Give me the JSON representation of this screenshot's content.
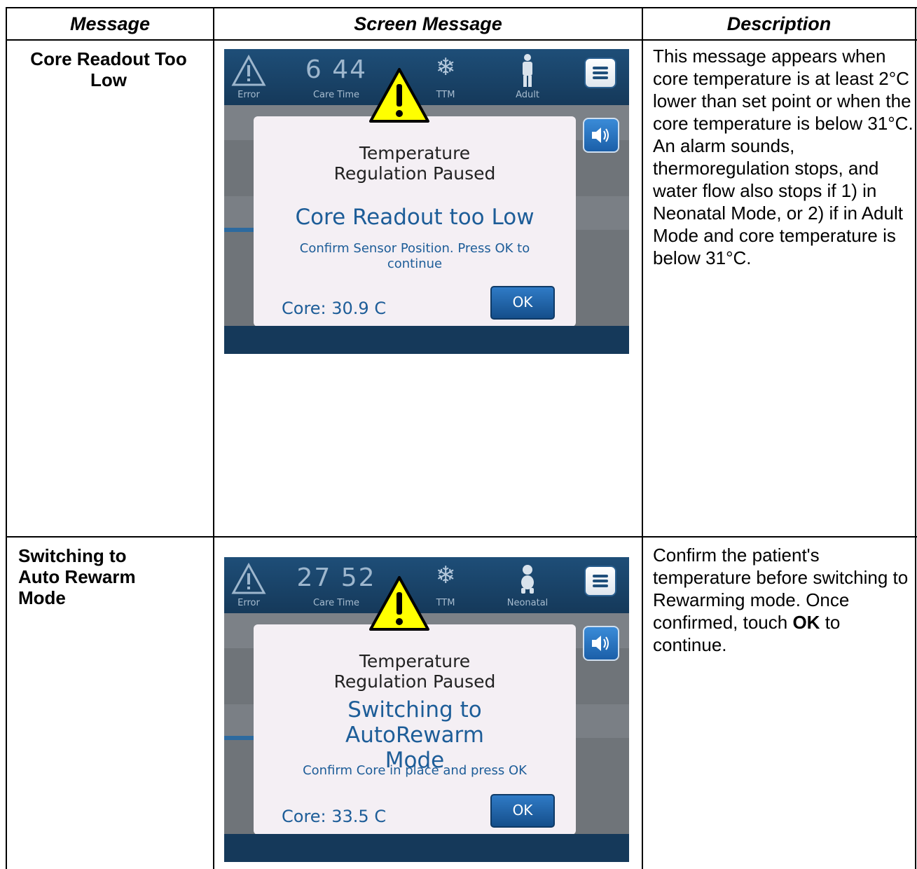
{
  "headers": {
    "message": "Message",
    "screen_message": "Screen Message",
    "description": "Description"
  },
  "rows": [
    {
      "message_label": "Core Readout Too Low",
      "screen": {
        "status_icon_label": "Error",
        "care_time": "6 44",
        "care_time_label": "Care Time",
        "therapy_label": "TTM",
        "patient_label": "Adult",
        "dialog_title": "Temperature Regulation Paused",
        "dialog_message": "Core Readout too Low",
        "dialog_instruction": "Confirm Sensor Position. Press OK to continue",
        "core_readout": "Core: 30.9 C",
        "ok_label": "OK"
      },
      "description": "This message appears when core temperature is at least 2°C lower than set point or when the core temperature is below 31°C. An alarm sounds, thermoregulation stops, and water flow also stops if 1) in Neonatal Mode, or 2) if in Adult Mode and core temperature is below 31°C."
    },
    {
      "message_label": "Switching to Auto Rewarm Mode",
      "screen": {
        "status_icon_label": "Error",
        "care_time": "27 52",
        "care_time_label": "Care Time",
        "therapy_label": "TTM",
        "patient_label": "Neonatal",
        "dialog_title": "Temperature Regulation Paused",
        "dialog_message": "Switching to AutoRewarm Mode",
        "dialog_instruction": "Confirm Core in place and press OK",
        "core_readout": "Core: 33.5 C",
        "ok_label": "OK"
      },
      "description_before": "Confirm the patient's temperature before switching to Rewarming mode. Once confirmed, touch",
      "description_bold": "OK",
      "description_after": "to continue."
    }
  ],
  "colors": {
    "topbar": "#1e4e78",
    "dialog_text_blue": "#1d5d98",
    "warning_yellow": "#ffff00",
    "ok_button": "#2f7bc6"
  },
  "icons": [
    "warning-triangle-icon",
    "snowflake-icon",
    "adult-figure-icon",
    "neonatal-figure-icon",
    "menu-icon",
    "speaker-icon"
  ]
}
